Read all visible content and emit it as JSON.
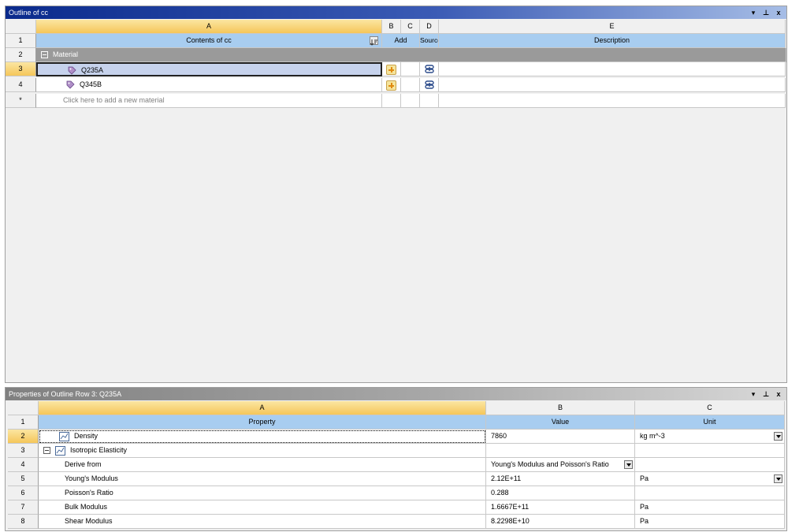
{
  "outline": {
    "title": "Outline of cc",
    "controls": [
      "▾",
      "⊥",
      "x"
    ],
    "columns": [
      "A",
      "B",
      "C",
      "D",
      "E"
    ],
    "header_row": {
      "num": "1",
      "contents": "Contents of cc",
      "add": "Add",
      "source": "Source",
      "description": "Description"
    },
    "group_row": {
      "num": "2",
      "label": "Material"
    },
    "rows": [
      {
        "num": "3",
        "name": "Q235A"
      },
      {
        "num": "4",
        "name": "Q345B"
      }
    ],
    "new_row": {
      "num": "*",
      "placeholder": "Click here to add a new material"
    }
  },
  "properties": {
    "title": "Properties of Outline Row 3: Q235A",
    "controls": [
      "▾",
      "⊥",
      "x"
    ],
    "columns": [
      "A",
      "B",
      "C"
    ],
    "header_row": {
      "num": "1",
      "property": "Property",
      "value": "Value",
      "unit": "Unit"
    },
    "rows": [
      {
        "num": "2",
        "property": "Density",
        "value": "7860",
        "unit": "kg m^-3"
      },
      {
        "num": "3",
        "property": "Isotropic Elasticity",
        "value": "",
        "unit": ""
      },
      {
        "num": "4",
        "property": "Derive from",
        "value": "Young's Modulus and Poisson's Ratio",
        "unit": ""
      },
      {
        "num": "5",
        "property": "Young's Modulus",
        "value": "2.12E+11",
        "unit": "Pa"
      },
      {
        "num": "6",
        "property": "Poisson's Ratio",
        "value": "0.288",
        "unit": ""
      },
      {
        "num": "7",
        "property": "Bulk Modulus",
        "value": "1.6667E+11",
        "unit": "Pa"
      },
      {
        "num": "8",
        "property": "Shear Modulus",
        "value": "8.2298E+10",
        "unit": "Pa"
      }
    ]
  },
  "colors": {
    "title_active": "#0a2a8c",
    "header": "#a8cdf0",
    "group": "#9a9a9a",
    "selected_col": "#f5c65a"
  }
}
